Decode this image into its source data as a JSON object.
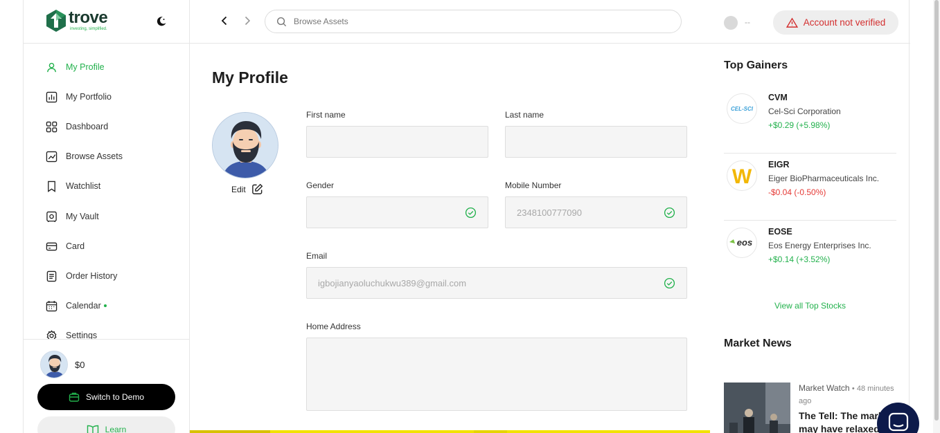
{
  "brand": {
    "name": "trove",
    "tagline": "investing, simplified."
  },
  "sidebar": {
    "items": [
      {
        "label": "My Profile",
        "icon": "user-icon",
        "active": true
      },
      {
        "label": "My Portfolio",
        "icon": "portfolio-icon"
      },
      {
        "label": "Dashboard",
        "icon": "dashboard-icon"
      },
      {
        "label": "Browse Assets",
        "icon": "chart-icon"
      },
      {
        "label": "Watchlist",
        "icon": "bookmark-icon"
      },
      {
        "label": "My Vault",
        "icon": "vault-icon"
      },
      {
        "label": "Card",
        "icon": "card-icon"
      },
      {
        "label": "Order History",
        "icon": "document-icon"
      },
      {
        "label": "Calendar",
        "icon": "calendar-icon"
      },
      {
        "label": "Settings",
        "icon": "gear-icon"
      }
    ],
    "balance": "$0",
    "demo_label": "Switch to Demo",
    "learn_label": "Learn"
  },
  "search": {
    "placeholder": "Browse Assets"
  },
  "header": {
    "user_name": "--",
    "verify_label": "Account not verified"
  },
  "profile": {
    "title": "My Profile",
    "edit_label": "Edit",
    "first_name": {
      "label": "First name",
      "value": ""
    },
    "last_name": {
      "label": "Last name",
      "value": ""
    },
    "gender": {
      "label": "Gender",
      "value": ""
    },
    "mobile": {
      "label": "Mobile Number",
      "value": "2348100777090"
    },
    "email": {
      "label": "Email",
      "value": "igbojianyaoluchukwu389@gmail.com"
    },
    "address": {
      "label": "Home Address",
      "value": ""
    }
  },
  "top_gainers": {
    "title": "Top Gainers",
    "items": [
      {
        "ticker": "CVM",
        "name": "Cel-Sci Corporation",
        "change": "+$0.29 (+5.98%)",
        "logo_text": "CEL-SCI"
      },
      {
        "ticker": "EIGR",
        "name": "Eiger BioPharmaceuticals Inc.",
        "change": "-$0.04 (-0.50%)",
        "logo_text": "W"
      },
      {
        "ticker": "EOSE",
        "name": "Eos Energy Enterprises Inc.",
        "change": "+$0.14 (+3.52%)",
        "logo_text": "eos"
      }
    ],
    "view_all": "View all Top Stocks"
  },
  "market_news": {
    "title": "Market News",
    "source": "Market Watch",
    "time": "48 minutes ago",
    "headline": "The Tell: The market may have relaxed"
  },
  "colors": {
    "accent": "#22b14c",
    "danger": "#d32f2f",
    "dark": "#000000"
  }
}
